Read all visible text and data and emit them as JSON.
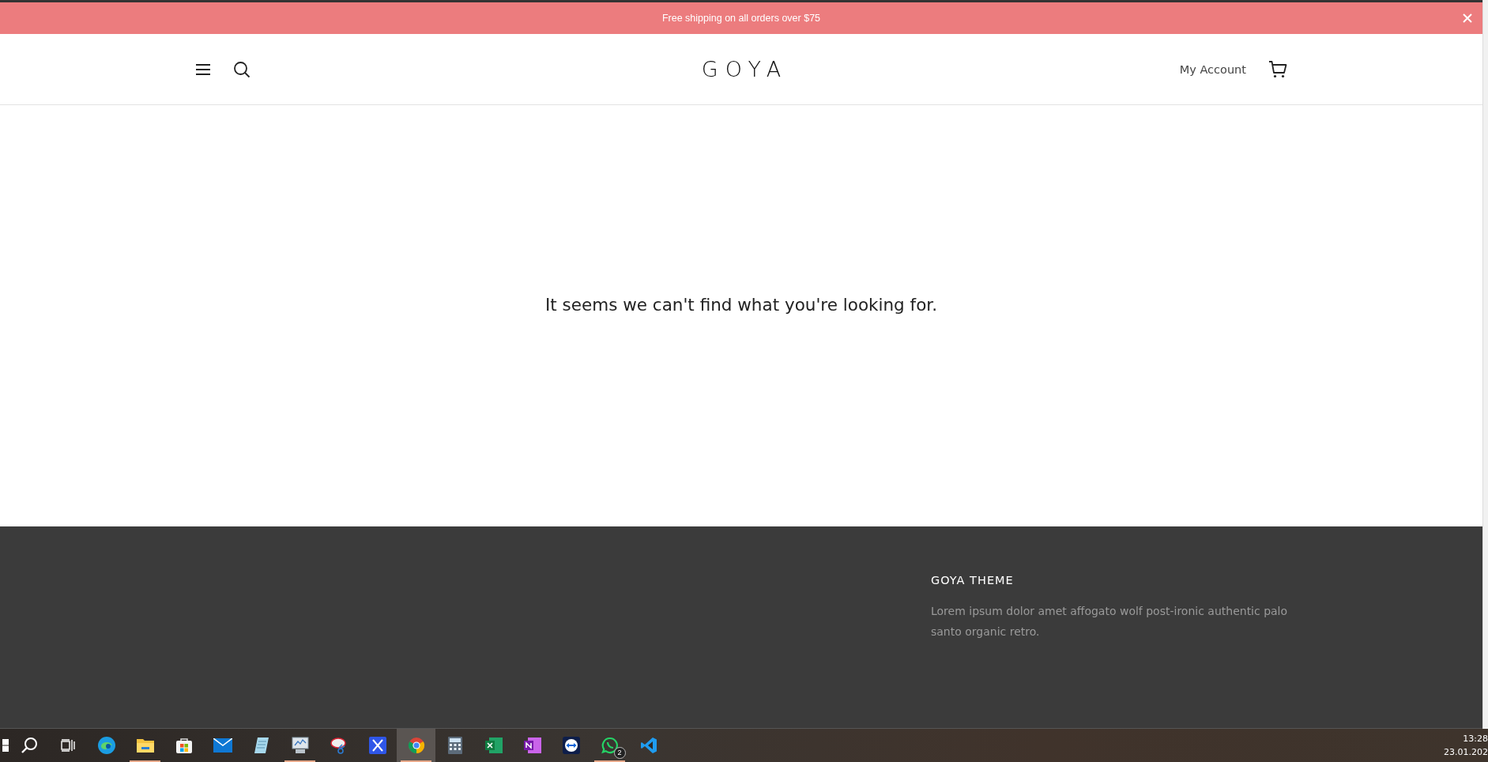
{
  "announcement": {
    "text": "Free shipping on all orders over $75"
  },
  "header": {
    "logo": "GOYA",
    "account_link": "My Account"
  },
  "main": {
    "message": "It seems we can't find what you're looking for."
  },
  "footer": {
    "heading": "GOYA THEME",
    "text": "Lorem ipsum dolor amet affogato wolf post-ironic authentic palo santo organic retro."
  },
  "taskbar": {
    "apps": [
      {
        "kind": "start",
        "running": false,
        "selected": false
      },
      {
        "kind": "search",
        "running": false,
        "selected": false
      },
      {
        "kind": "taskview",
        "running": false,
        "selected": false
      },
      {
        "kind": "edge",
        "running": false,
        "selected": false
      },
      {
        "kind": "explorer",
        "running": true,
        "selected": false
      },
      {
        "kind": "store",
        "running": false,
        "selected": false
      },
      {
        "kind": "mail",
        "running": false,
        "selected": false
      },
      {
        "kind": "notepad",
        "running": false,
        "selected": false
      },
      {
        "kind": "monitor",
        "running": true,
        "selected": false
      },
      {
        "kind": "snip",
        "running": false,
        "selected": false
      },
      {
        "kind": "bluex",
        "running": false,
        "selected": false
      },
      {
        "kind": "chrome",
        "running": true,
        "selected": true
      },
      {
        "kind": "calculator",
        "running": false,
        "selected": false
      },
      {
        "kind": "excel",
        "running": false,
        "selected": false
      },
      {
        "kind": "onenote",
        "running": false,
        "selected": false
      },
      {
        "kind": "teamviewer",
        "running": false,
        "selected": false
      },
      {
        "kind": "whatsapp",
        "running": true,
        "selected": false,
        "badge": "2"
      },
      {
        "kind": "vscode",
        "running": false,
        "selected": false
      }
    ],
    "time": "13:28",
    "date": "23.01.202"
  }
}
